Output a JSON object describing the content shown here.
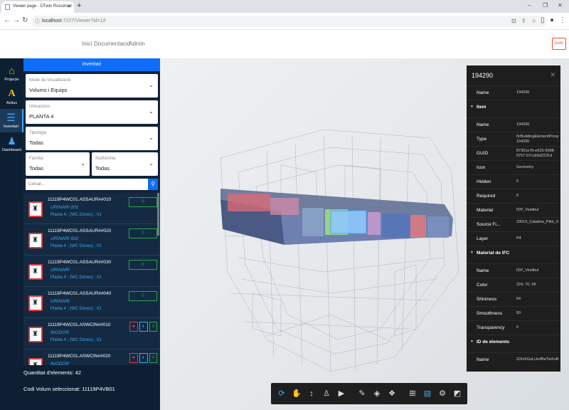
{
  "browser": {
    "tab_title": "Viewer page - DTwin Rossiman",
    "url_host": "localhost",
    "url_rest": ":7227/Viewer?id=1#"
  },
  "header": {
    "menu": [
      "Inici",
      "Documentació",
      "Admin"
    ],
    "logout_label": "Sortir"
  },
  "rail": [
    {
      "label": "Projecte",
      "icon": "home-icon"
    },
    {
      "label": "Actius",
      "icon": "letter-a-icon"
    },
    {
      "label": "Inventari",
      "icon": "list-icon"
    },
    {
      "label": "Dashboard",
      "icon": "users-icon"
    }
  ],
  "inventory": {
    "title": "Inventari",
    "mode": {
      "label": "Mode de Visualització",
      "value": "Volums i Equips"
    },
    "location": {
      "label": "Ubicacions",
      "value": "PLANTA 4"
    },
    "typology": {
      "label": "Tipologia",
      "value": "Todas"
    },
    "family": {
      "label": "Família",
      "value": "Todas"
    },
    "subfamily": {
      "label": "Subfamília",
      "value": "Todas"
    },
    "search_placeholder": "Cercar...",
    "items": [
      {
        "code": "11119P4WC01.ASSAUR##010",
        "name": "URINARI 001",
        "loc": "Planta 4 : (WC Dones) : 01",
        "count": "0",
        "extra": false
      },
      {
        "code": "11119P4WC01.ASSAUR##020",
        "name": "URINARI 002",
        "loc": "Planta 4 : (WC Dones) : 01",
        "count": "0",
        "extra": false
      },
      {
        "code": "11119P4WC01.ASSAUR##030",
        "name": "URINARI",
        "loc": "Planta 4 : (WC Dones) : 01",
        "count": "0",
        "extra": false
      },
      {
        "code": "11119P4WC01.ASSAUR##040",
        "name": "URINARI",
        "loc": "Planta 4 : (WC Dones) : 01",
        "count": "0",
        "extra": false
      },
      {
        "code": "11119P4WC01.ASWCIN##010",
        "name": "INODOR",
        "loc": "Planta 4 : (WC Dones) : 01",
        "count": "0",
        "extra": true
      },
      {
        "code": "11119P4WC01.ASWCIN##020",
        "name": "INODOR",
        "loc": "",
        "count": "0",
        "extra": true
      }
    ],
    "count_label": "Quantitat d'elements: 42",
    "selected_label": "Codi Volum seleccionat: 11119P4VB01"
  },
  "properties": {
    "title": "194290",
    "rows": [
      {
        "type": "row",
        "k": "Name",
        "v": "194290"
      },
      {
        "type": "section",
        "k": "Item"
      },
      {
        "type": "row",
        "k": "Name",
        "v": "194290"
      },
      {
        "type": "row",
        "k": "Type",
        "v": "IfcBuildingElementProxy: 194290"
      },
      {
        "type": "row",
        "k": "GUID",
        "v": "87301e7b-e625-5088-9757-07ccb5d2231d"
      },
      {
        "type": "row",
        "k": "Icon",
        "v": "Geometry"
      },
      {
        "type": "row",
        "k": "Hidden",
        "v": "0"
      },
      {
        "type": "row",
        "k": "Required",
        "v": "0"
      },
      {
        "type": "row",
        "k": "Material",
        "v": "IDP_Vestibul"
      },
      {
        "type": "row",
        "k": "Source Fi...",
        "v": "23019_Calabria_Pilot_V3.ifc"
      },
      {
        "type": "row",
        "k": "Layer",
        "v": "P4"
      },
      {
        "type": "section",
        "k": "Material de IFC"
      },
      {
        "type": "row",
        "k": "Name",
        "v": "IDP_Vestibul"
      },
      {
        "type": "row",
        "k": "Color",
        "v": "224, 70, 68"
      },
      {
        "type": "row",
        "k": "Shininess",
        "v": "64"
      },
      {
        "type": "row",
        "k": "Smoothness",
        "v": "50"
      },
      {
        "type": "row",
        "k": "Transparency",
        "v": "0"
      },
      {
        "type": "section",
        "k": "ID de elemento"
      },
      {
        "type": "row",
        "k": "Name",
        "v": "1DHXGoLUe4BeTwXoRhawG6"
      }
    ]
  },
  "toolbar": [
    {
      "name": "orbit-tool",
      "icon": "orbit-icon",
      "glyph": "⟳",
      "active": true
    },
    {
      "name": "pan-tool",
      "icon": "hand-icon",
      "glyph": "✋",
      "active": false
    },
    {
      "name": "zoom-tool",
      "icon": "updown-icon",
      "glyph": "↕",
      "active": false
    },
    {
      "name": "walk-tool",
      "icon": "person-icon",
      "glyph": "♙",
      "active": false
    },
    {
      "name": "camera-tool",
      "icon": "camera-icon",
      "glyph": "▶",
      "active": false
    },
    {
      "name": "measure-tool",
      "icon": "ruler-icon",
      "glyph": "✎",
      "active": false
    },
    {
      "name": "section-tool",
      "icon": "section-icon",
      "glyph": "◈",
      "active": false
    },
    {
      "name": "explode-tool",
      "icon": "cube-icon",
      "glyph": "❖",
      "active": false
    },
    {
      "name": "model-tree-tool",
      "icon": "tree-icon",
      "glyph": "⊞",
      "active": false
    },
    {
      "name": "properties-tool",
      "icon": "properties-icon",
      "glyph": "▤",
      "active": true
    },
    {
      "name": "settings-tool",
      "icon": "gear-icon",
      "glyph": "⚙",
      "active": false
    },
    {
      "name": "fullscreen-tool",
      "icon": "fullscreen-icon",
      "glyph": "◩",
      "active": false
    }
  ]
}
